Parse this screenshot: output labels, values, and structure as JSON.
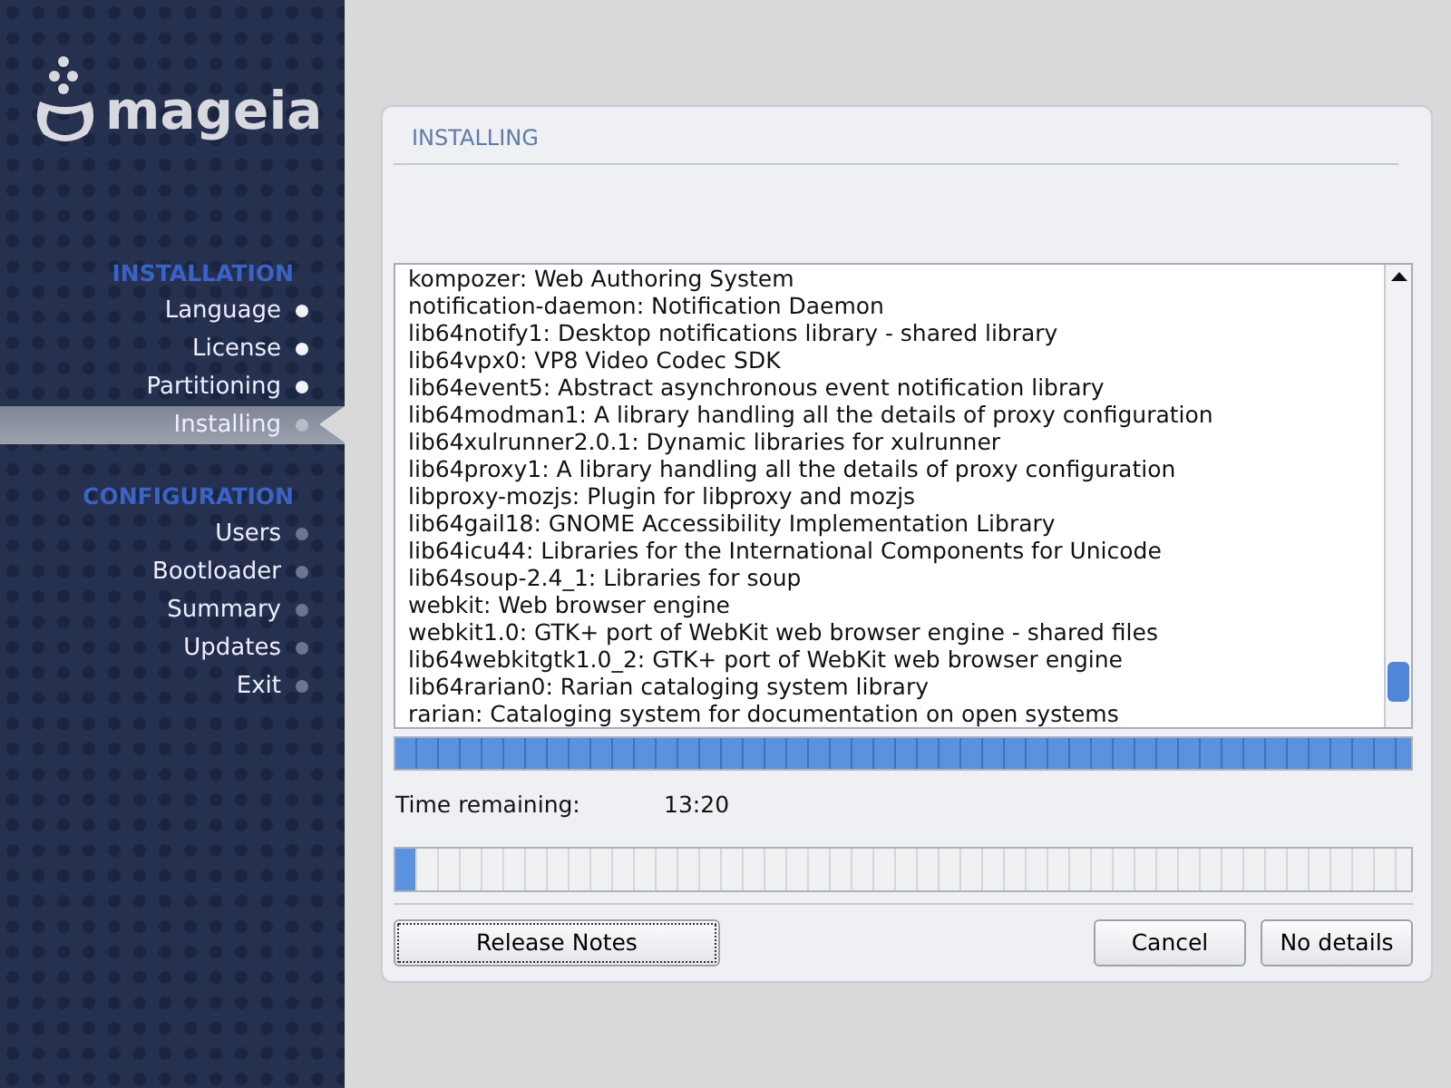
{
  "logo": {
    "text": "mageia"
  },
  "sidebar": {
    "sections": [
      {
        "title": "INSTALLATION",
        "items": [
          {
            "label": "Language",
            "done": true,
            "selected": false
          },
          {
            "label": "License",
            "done": true,
            "selected": false
          },
          {
            "label": "Partitioning",
            "done": true,
            "selected": false
          },
          {
            "label": "Installing",
            "done": false,
            "selected": true
          }
        ]
      },
      {
        "title": "CONFIGURATION",
        "items": [
          {
            "label": "Users",
            "done": false,
            "selected": false
          },
          {
            "label": "Bootloader",
            "done": false,
            "selected": false
          },
          {
            "label": "Summary",
            "done": false,
            "selected": false
          },
          {
            "label": "Updates",
            "done": false,
            "selected": false
          },
          {
            "label": "Exit",
            "done": false,
            "selected": false
          }
        ]
      }
    ]
  },
  "panel": {
    "title": "INSTALLING",
    "log": [
      "kompozer: Web Authoring System",
      "notification-daemon: Notification Daemon",
      "lib64notify1: Desktop notifications library - shared library",
      "lib64vpx0: VP8 Video Codec SDK",
      "lib64event5: Abstract asynchronous event notification library",
      "lib64modman1: A library handling all the details of proxy configuration",
      "lib64xulrunner2.0.1: Dynamic libraries for xulrunner",
      "lib64proxy1: A library handling all the details of proxy configuration",
      "libproxy-mozjs: Plugin for libproxy and mozjs",
      "lib64gail18: GNOME Accessibility Implementation Library",
      "lib64icu44: Libraries for the International Components for Unicode",
      "lib64soup-2.4_1: Libraries for soup",
      "webkit: Web browser engine",
      "webkit1.0: GTK+ port of WebKit web browser engine - shared files",
      "lib64webkitgtk1.0_2: GTK+ port of WebKit web browser engine",
      "lib64rarian0: Rarian cataloging system library",
      "rarian: Cataloging system for documentation on open systems"
    ],
    "package_progress": {
      "level": 1
    },
    "time_label": "Time remaining:",
    "time_value": "13:20",
    "total_progress": {
      "level": 0.02
    },
    "buttons": [
      {
        "label": "Release Notes",
        "focused": true
      },
      {
        "label": "Cancel",
        "focused": false
      },
      {
        "label": "No details",
        "focused": false
      }
    ]
  }
}
